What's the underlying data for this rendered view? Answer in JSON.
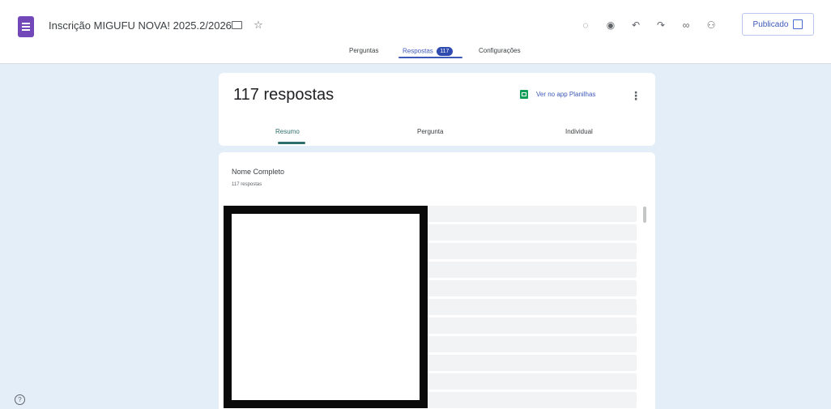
{
  "header": {
    "title": "Inscrição MIGUFU NOVA! 2025.2/2026",
    "icons": [
      "forms-app-icon",
      "folder-icon",
      "star-icon"
    ],
    "actions": [
      {
        "name": "palette-icon",
        "glyph": "◌"
      },
      {
        "name": "preview-eye-icon",
        "glyph": "◉"
      },
      {
        "name": "undo-icon",
        "glyph": "↶"
      },
      {
        "name": "redo-icon",
        "glyph": "↷"
      },
      {
        "name": "link-icon",
        "glyph": "∞"
      },
      {
        "name": "add-collaborator-icon",
        "glyph": "⚇"
      }
    ],
    "publish_label": "Publicado"
  },
  "tabs": {
    "perguntas": "Perguntas",
    "respostas": "Respostas",
    "respostas_count": "117",
    "configuracoes": "Configurações"
  },
  "summary": {
    "count_label": "117 respostas",
    "sheets_link": "Ver no app Planilhas",
    "more_glyph": "⋮",
    "subtabs": {
      "resumo": "Resumo",
      "pergunta": "Pergunta",
      "individual": "Individual"
    }
  },
  "question": {
    "title": "Nome Completo",
    "responses": "117 respostas"
  },
  "colors": {
    "page_bg": "#e3eef9",
    "accent": "#3d59b8",
    "forms_purple": "#7248b9",
    "sheets_green": "#0f9d58",
    "subtab_active": "#2f6e6e"
  }
}
